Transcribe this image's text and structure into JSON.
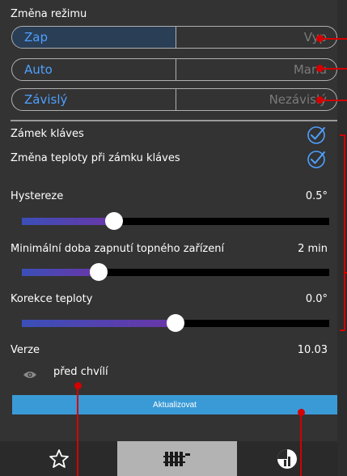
{
  "mode_section": {
    "title": "Změna režimu",
    "toggles": [
      {
        "on": "Zap",
        "off": "Vyp"
      },
      {
        "on": "Auto",
        "off": "Manu"
      },
      {
        "on": "Závislý",
        "off": "Nezávislý"
      }
    ]
  },
  "settings": {
    "key_lock_label": "Zámek kláves",
    "key_lock_checked": true,
    "temp_change_lock_label": "Změna teploty při zámku kláves",
    "temp_change_lock_checked": true,
    "sliders": [
      {
        "label": "Hystereze",
        "value": "0.5°",
        "fraction": 0.3
      },
      {
        "label": "Minimální doba zapnutí topného zařízení",
        "value": "2 min",
        "fraction": 0.25
      },
      {
        "label": "Korekce teploty",
        "value": "0.0°",
        "fraction": 0.5
      }
    ]
  },
  "version": {
    "label": "Verze",
    "value": "10.03"
  },
  "last_update": {
    "text": "před chvílí",
    "icon": "eye-icon"
  },
  "refresh_button": {
    "label": "Aktualizovat"
  },
  "bottom_nav": [
    {
      "icon": "star-icon",
      "active": false
    },
    {
      "icon": "radiator-icon",
      "active": true
    },
    {
      "icon": "stats-icon",
      "active": false
    }
  ],
  "colors": {
    "accent": "#4ea0ff",
    "button": "#3a9ad6",
    "annotation": "#d40000"
  }
}
